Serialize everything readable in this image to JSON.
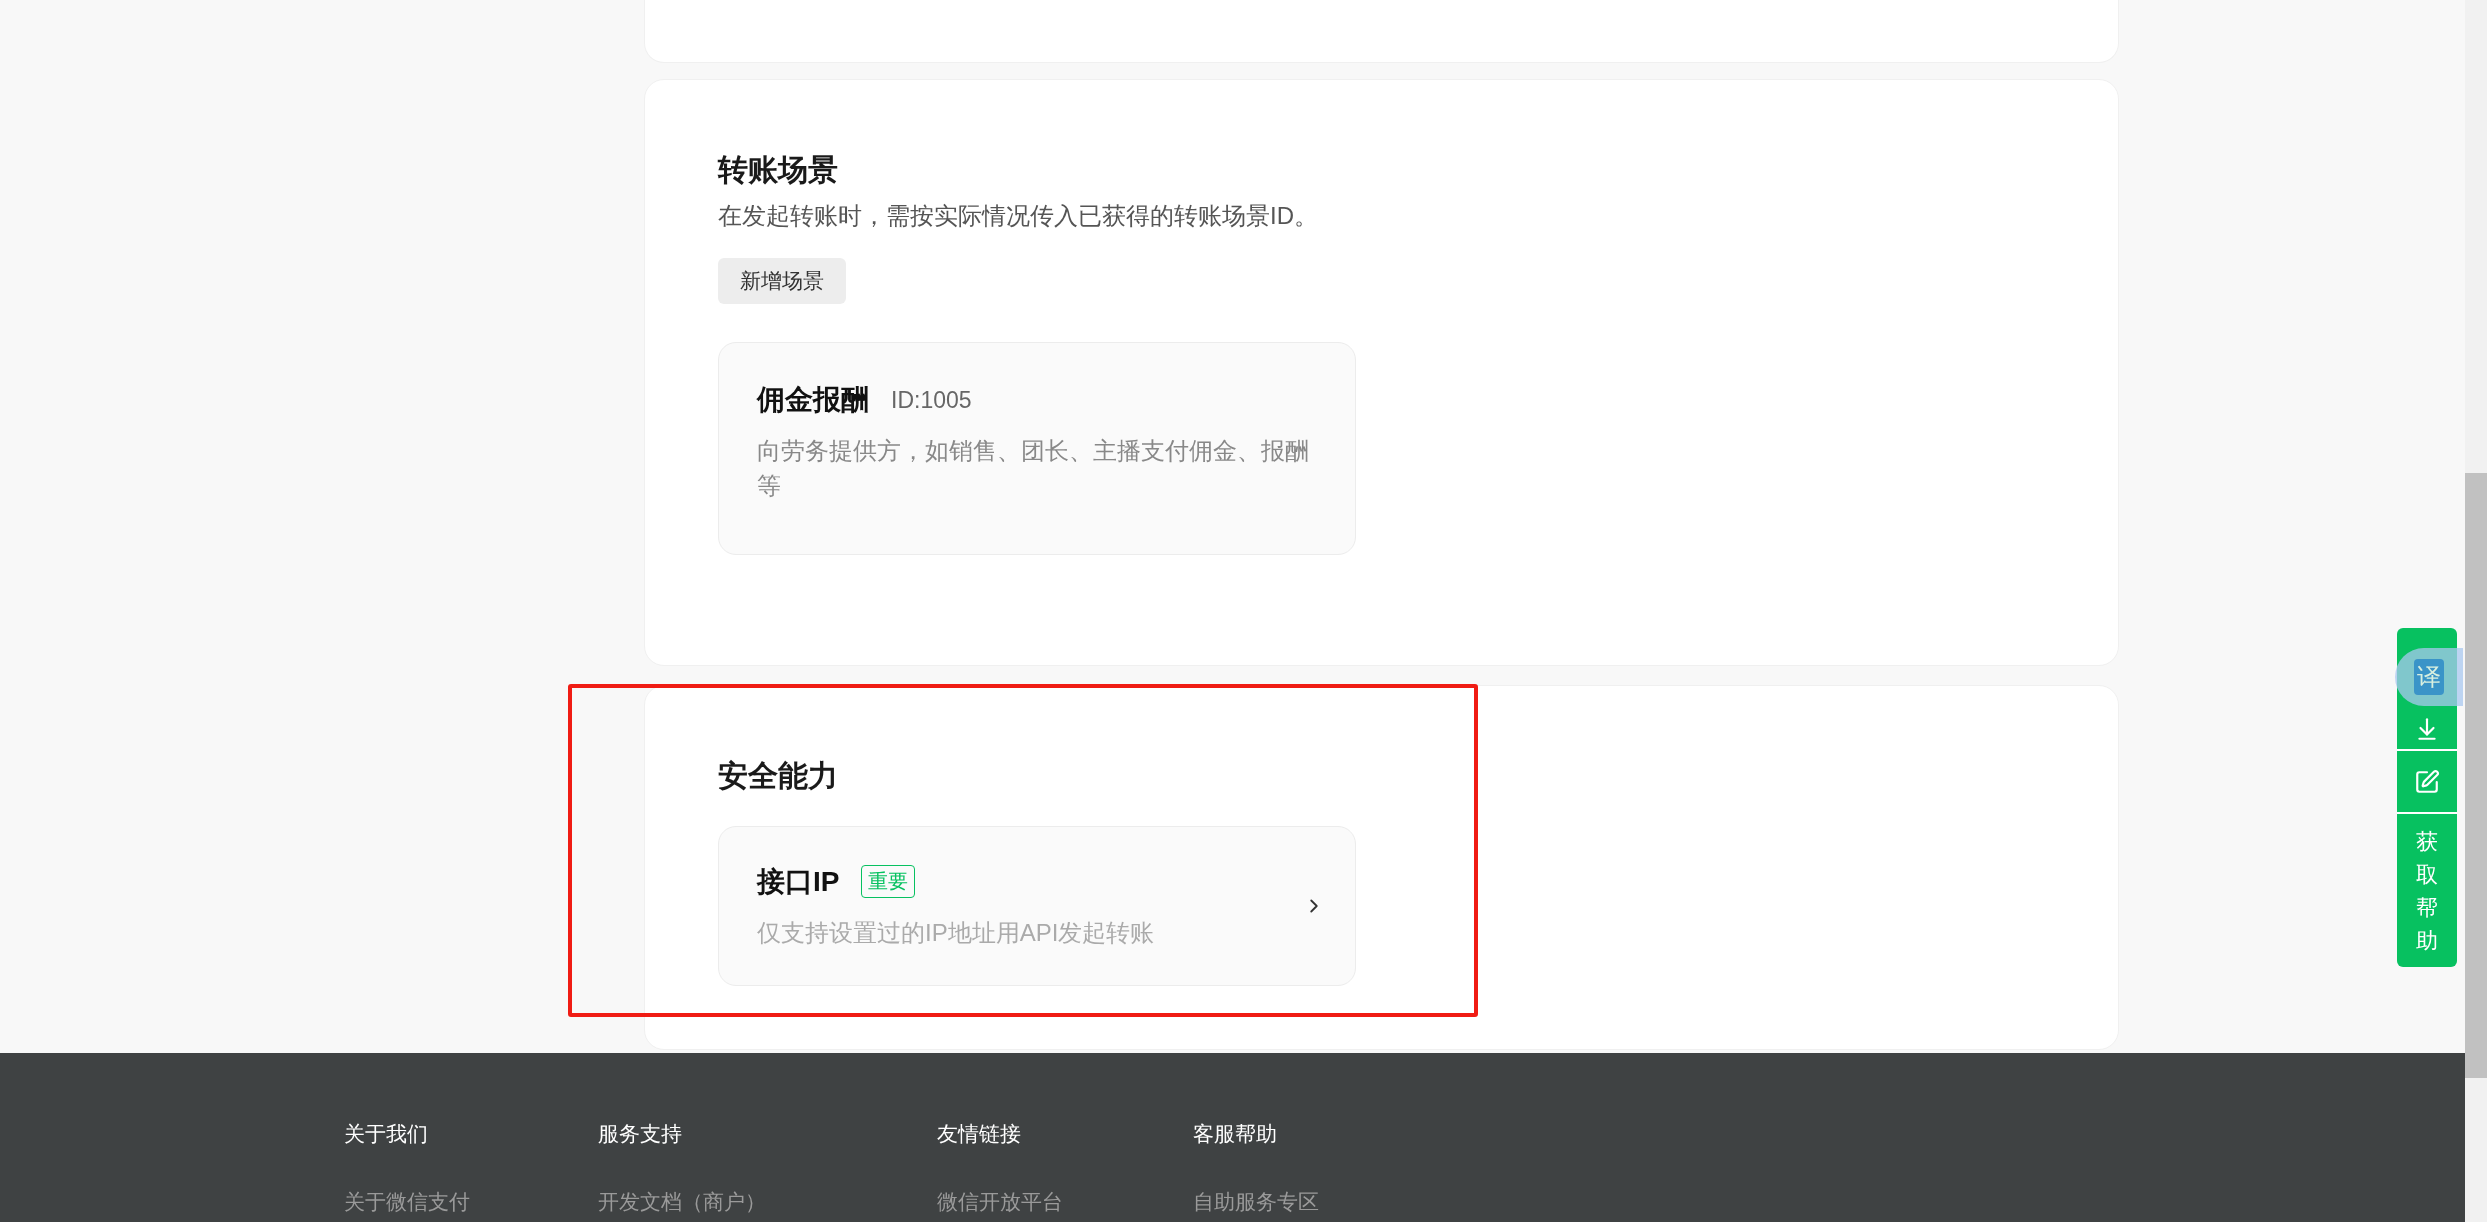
{
  "sections": [
    {
      "title": "转账场景",
      "description": "在发起转账时，需按实际情况传入已获得的转账场景ID。",
      "button": "新增场景",
      "items": [
        {
          "title": "佣金报酬",
          "id": "ID:1005",
          "description": "向劳务提供方，如销售、团长、主播支付佣金、报酬等",
          "has_arrow": false
        }
      ]
    },
    {
      "title": "安全能力",
      "items": [
        {
          "title": "接口IP",
          "tag": "重要",
          "description": "仅支持设置过的IP地址用API发起转账",
          "has_arrow": true
        }
      ]
    }
  ],
  "float_bar": {
    "translate": "译",
    "help": "获取帮助"
  },
  "footer": {
    "columns": [
      {
        "heading": "关于我们",
        "links": [
          "关于微信支付"
        ]
      },
      {
        "heading": "服务支持",
        "links": [
          "开发文档（商户）"
        ]
      },
      {
        "heading": "友情链接",
        "links": [
          "微信开放平台"
        ]
      },
      {
        "heading": "客服帮助",
        "links": [
          "自助服务专区"
        ]
      }
    ]
  }
}
